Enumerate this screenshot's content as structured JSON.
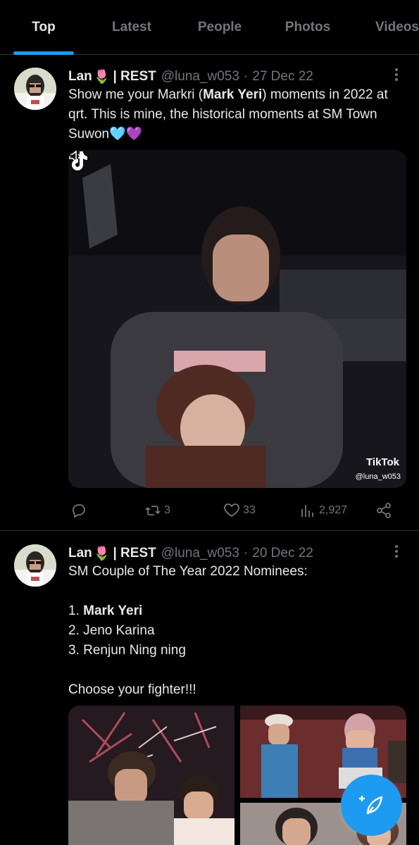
{
  "tabs": [
    {
      "label": "Top",
      "active": true
    },
    {
      "label": "Latest",
      "active": false
    },
    {
      "label": "People",
      "active": false
    },
    {
      "label": "Photos",
      "active": false
    },
    {
      "label": "Videos",
      "active": false
    }
  ],
  "tweets": [
    {
      "author_name": "Lan",
      "author_emoji": "🌷",
      "author_suffix": "| REST",
      "handle": "@luna_w053",
      "date": "27 Dec 22",
      "text_a": "Show me your Markri (",
      "text_bold": "Mark Yeri",
      "text_b": ") moments in 2022 at qrt. This is mine, the historical moments at SM Town Suwon",
      "text_emoji": "🩵💜",
      "media_watermark": "TikTok",
      "media_user": "@luna_w053",
      "reply_count": "",
      "retweet_count": "3",
      "like_count": "33",
      "view_count": "2,927"
    },
    {
      "author_name": "Lan",
      "author_emoji": "🌷",
      "author_suffix": "| REST",
      "handle": "@luna_w053",
      "date": "20 Dec 22",
      "line1": "SM Couple of The Year 2022 Nominees:",
      "item1_prefix": "1. ",
      "item1_bold": "Mark Yeri",
      "item2": "2. Jeno Karina",
      "item3": "3. Renjun Ning ning",
      "line_final": "Choose your fighter!!!"
    }
  ],
  "icons": {
    "reply": "reply-icon",
    "retweet": "retweet-icon",
    "like": "heart-icon",
    "views": "views-chart-icon",
    "share": "share-icon",
    "compose": "compose-tweet-icon",
    "more": "more-options-icon"
  },
  "colors": {
    "accent": "#1d9bf0",
    "muted": "#71767b",
    "text": "#e7e9ea",
    "background": "#000000"
  }
}
